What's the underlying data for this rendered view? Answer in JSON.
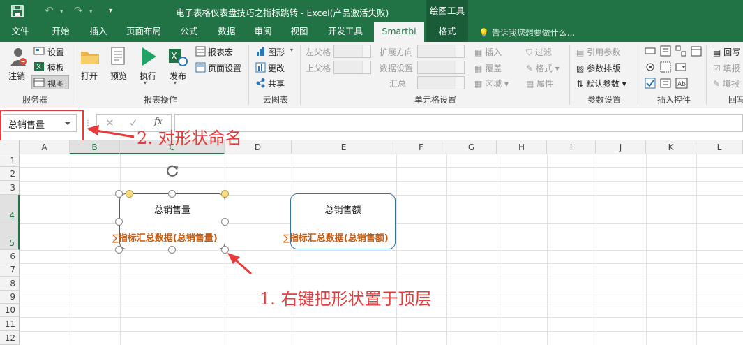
{
  "titlebar": {
    "title": "电子表格仪表盘技巧之指标跳转 - Excel(产品激活失败)",
    "context_tools": "绘图工具"
  },
  "tabs": [
    "文件",
    "开始",
    "插入",
    "页面布局",
    "公式",
    "数据",
    "审阅",
    "视图",
    "开发工具",
    "Smartbi",
    "格式"
  ],
  "tell_me": "告诉我您想要做什么...",
  "ribbon": {
    "server": {
      "label": "服务器",
      "logout": "注销",
      "settings": "设置",
      "template": "模板",
      "view": "视图"
    },
    "report_ops": {
      "label": "报表操作",
      "open": "打开",
      "preview": "预览",
      "run": "执行",
      "publish": "发布",
      "macro": "报表宏",
      "page_setup": "页面设置"
    },
    "cloud": {
      "label": "云图表",
      "shape": "图形",
      "update": "更改",
      "share": "共享"
    },
    "cell_settings": {
      "label": "单元格设置",
      "left_parent": "左父格",
      "up_parent": "上父格",
      "expand_dir": "扩展方向",
      "data_settings": "数据设置",
      "summary": "汇总",
      "insert": "插入",
      "cover": "覆盖",
      "area": "区域",
      "filter": "过滤",
      "format": "格式",
      "attribute": "属性"
    },
    "param_settings": {
      "label": "参数设置",
      "ref_param": "引用参数",
      "param_layout": "参数排版",
      "default_param": "默认参数"
    },
    "insert_controls": {
      "label": "插入控件"
    },
    "writeback": {
      "label": "回写",
      "item1": "回写",
      "item2": "填报",
      "item3": "填报"
    }
  },
  "namebox": {
    "value": "总销售量"
  },
  "columns": [
    "A",
    "B",
    "C",
    "D",
    "E",
    "F",
    "G",
    "H",
    "I",
    "J",
    "K",
    "L"
  ],
  "rows": [
    "1",
    "2",
    "3",
    "4",
    "5",
    "6",
    "7",
    "8",
    "9",
    "10",
    "11",
    "12"
  ],
  "shapes": [
    {
      "title": "总销售量",
      "field": "指标汇总数据(总销售量)"
    },
    {
      "title": "总销售额",
      "field": "指标汇总数据(总销售额)"
    }
  ],
  "sigma": "∑",
  "annotations": {
    "step1": "1. 右键把形状置于顶层",
    "step2": "2. 对形状命名"
  },
  "colors": {
    "excel_green": "#217346",
    "annotation_red": "#e83a3a",
    "field_orange": "#c55a11",
    "shape_border": "#2e75b6"
  }
}
